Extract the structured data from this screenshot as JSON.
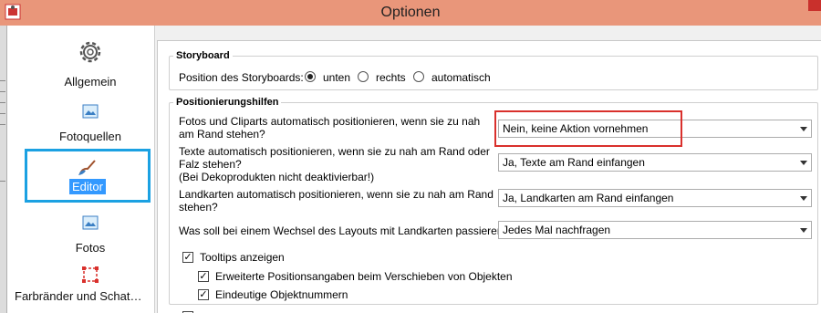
{
  "window": {
    "title": "Optionen"
  },
  "sidebar": {
    "items": [
      {
        "label": "Allgemein",
        "icon": "gear-icon"
      },
      {
        "label": "Fotoquellen",
        "icon": "image-icon"
      },
      {
        "label": "Editor",
        "icon": "brush-icon",
        "selected": true
      },
      {
        "label": "Fotos",
        "icon": "image-icon"
      },
      {
        "label": "Farbränder und Schat…",
        "icon": "selection-frame-icon"
      }
    ]
  },
  "storyboard": {
    "legend": "Storyboard",
    "position_label": "Position des Storyboards:",
    "options": [
      "unten",
      "rechts",
      "automatisch"
    ],
    "selected": "unten"
  },
  "positioning": {
    "legend": "Positionierungshilfen",
    "rows": [
      {
        "question": "Fotos und Cliparts automatisch positionieren, wenn sie zu nah am Rand stehen?",
        "value": "Nein, keine Aktion vornehmen"
      },
      {
        "question": "Texte automatisch positionieren, wenn sie zu nah am Rand oder Falz stehen?",
        "note": "(Bei Dekoprodukten nicht deaktivierbar!)",
        "value": "Ja, Texte am Rand einfangen"
      },
      {
        "question": "Landkarten automatisch positionieren, wenn sie zu nah am Rand stehen?",
        "value": "Ja, Landkarten am Rand einfangen"
      },
      {
        "question": "Was soll bei einem Wechsel des Layouts mit Landkarten passieren?",
        "value": "Jedes Mal nachfragen"
      }
    ]
  },
  "checkboxes": [
    {
      "label": "Tooltips anzeigen",
      "checked": true
    },
    {
      "label": "Erweiterte Positionsangaben beim Verschieben von Objekten",
      "checked": true
    },
    {
      "label": "Eindeutige Objektnummern",
      "checked": true
    }
  ],
  "colors": {
    "titlebar": "#e9967a",
    "selection": "#3399ff",
    "selected_border": "#1ba1e2",
    "highlight": "#d9302c"
  }
}
